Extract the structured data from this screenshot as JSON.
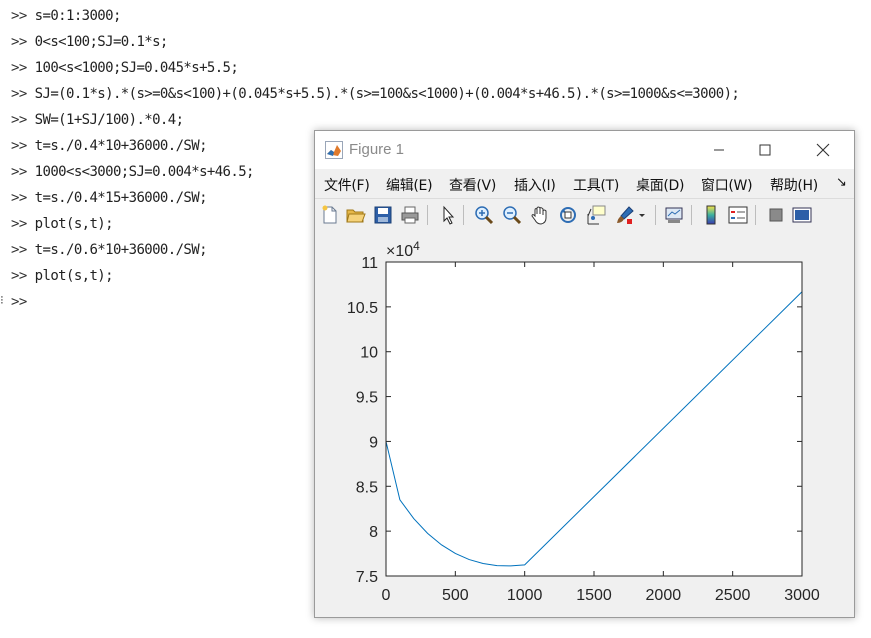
{
  "console": {
    "prompt": ">>",
    "lines": [
      "s=0:1:3000;",
      "0<s<100;SJ=0.1*s;",
      "100<s<1000;SJ=0.045*s+5.5;",
      "SJ=(0.1*s).*(s>=0&s<100)+(0.045*s+5.5).*(s>=100&s<1000)+(0.004*s+46.5).*(s>=1000&s<=3000);",
      "SW=(1+SJ/100).*0.4;",
      "t=s./0.4*10+36000./SW;",
      "1000<s<3000;SJ=0.004*s+46.5;",
      "t=s./0.4*15+36000./SW;",
      "plot(s,t);",
      "t=s./0.6*10+36000./SW;",
      "plot(s,t);",
      ""
    ]
  },
  "figure": {
    "title": "Figure 1",
    "menus": [
      "文件(F)",
      "编辑(E)",
      "查看(V)",
      "插入(I)",
      "工具(T)",
      "桌面(D)",
      "窗口(W)",
      "帮助(H)"
    ],
    "menu_overflow": "↘",
    "toolbar_icons": [
      "new-figure-icon",
      "open-file-icon",
      "save-icon",
      "print-icon",
      "edit-plot-arrow-icon",
      "zoom-in-icon",
      "zoom-out-icon",
      "pan-hand-icon",
      "rotate-3d-icon",
      "data-cursor-icon",
      "brush-icon",
      "brush-dropdown-icon",
      "link-plot-icon",
      "insert-colorbar-icon",
      "insert-legend-icon",
      "hide-plot-tools-icon",
      "show-plot-tools-icon"
    ]
  },
  "chart_data": {
    "type": "line",
    "xlim": [
      0,
      3000
    ],
    "ylim": [
      75000,
      110000
    ],
    "x_ticks": [
      0,
      500,
      1000,
      1500,
      2000,
      2500,
      3000
    ],
    "y_ticks": [
      7.5,
      8,
      8.5,
      9,
      9.5,
      10,
      10.5,
      11
    ],
    "y_exponent_label": "×10",
    "y_exponent_power": "4",
    "grid": false,
    "line_color": "#0072bd",
    "series": [
      {
        "x": [
          0,
          100,
          200,
          300,
          400,
          500,
          600,
          700,
          800,
          900,
          1000,
          3000
        ],
        "y": [
          90000,
          83498,
          81400,
          79749,
          78472,
          77513,
          76829,
          76389,
          76160,
          76123,
          76242,
          106679
        ]
      }
    ]
  }
}
